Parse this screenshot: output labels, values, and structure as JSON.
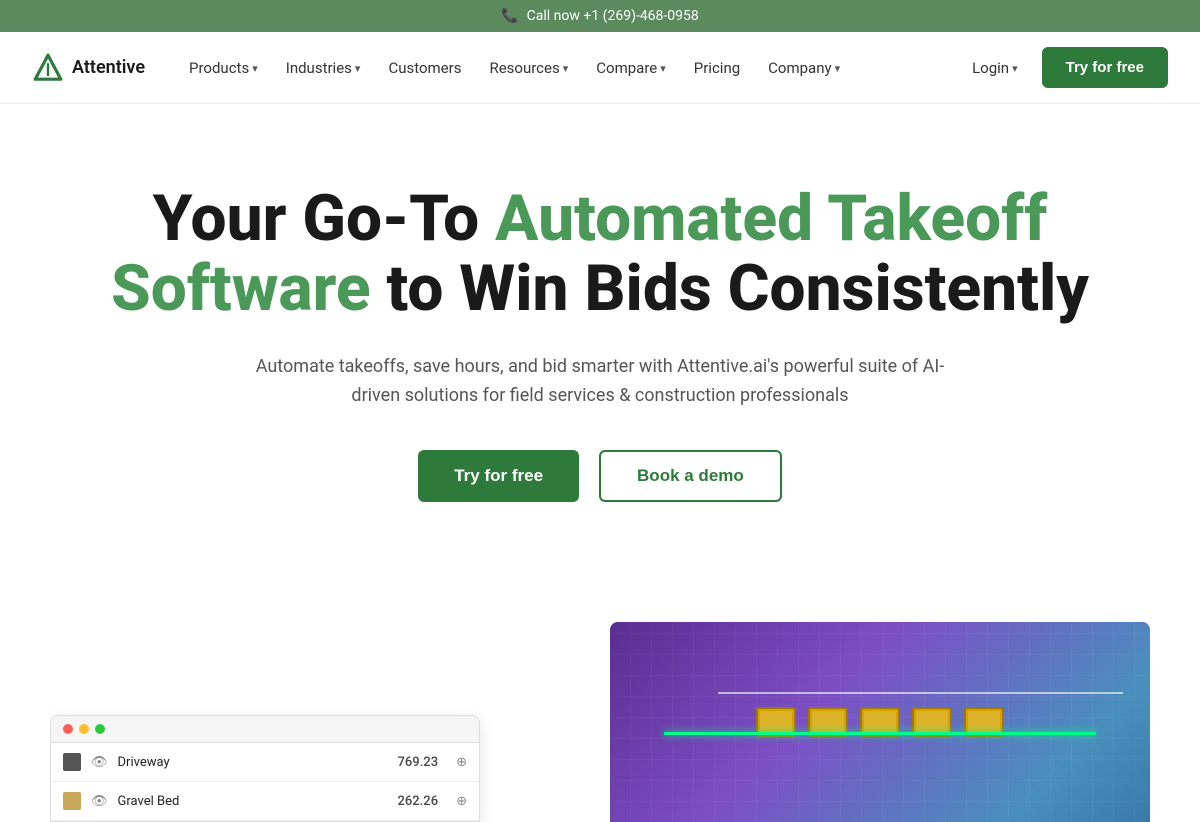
{
  "topbar": {
    "phone_icon": "📞",
    "text": "Call now +1 (269)-468-0958"
  },
  "nav": {
    "logo_name": "Attentive",
    "items": [
      {
        "label": "Products",
        "has_dropdown": true
      },
      {
        "label": "Industries",
        "has_dropdown": true
      },
      {
        "label": "Customers",
        "has_dropdown": false
      },
      {
        "label": "Resources",
        "has_dropdown": true
      },
      {
        "label": "Compare",
        "has_dropdown": true
      },
      {
        "label": "Pricing",
        "has_dropdown": false
      },
      {
        "label": "Company",
        "has_dropdown": true
      }
    ],
    "login_label": "Login",
    "try_free_label": "Try for free"
  },
  "hero": {
    "title_part1": "Your Go-To ",
    "title_green": "Automated Takeoff",
    "title_part2": "Software",
    "title_part3": " to Win Bids Consistently",
    "subtitle": "Automate takeoffs, save hours, and bid smarter with Attentive.ai's powerful suite of AI-driven solutions for field services & construction professionals",
    "btn_primary": "Try for free",
    "btn_outline": "Book a demo"
  },
  "preview": {
    "rows": [
      {
        "color": "#555",
        "label": "Driveway",
        "value": "769.23",
        "swatch_color": "#555"
      },
      {
        "color": "#c8a858",
        "label": "Gravel Bed",
        "value": "262.26",
        "swatch_color": "#c8a858"
      }
    ]
  }
}
